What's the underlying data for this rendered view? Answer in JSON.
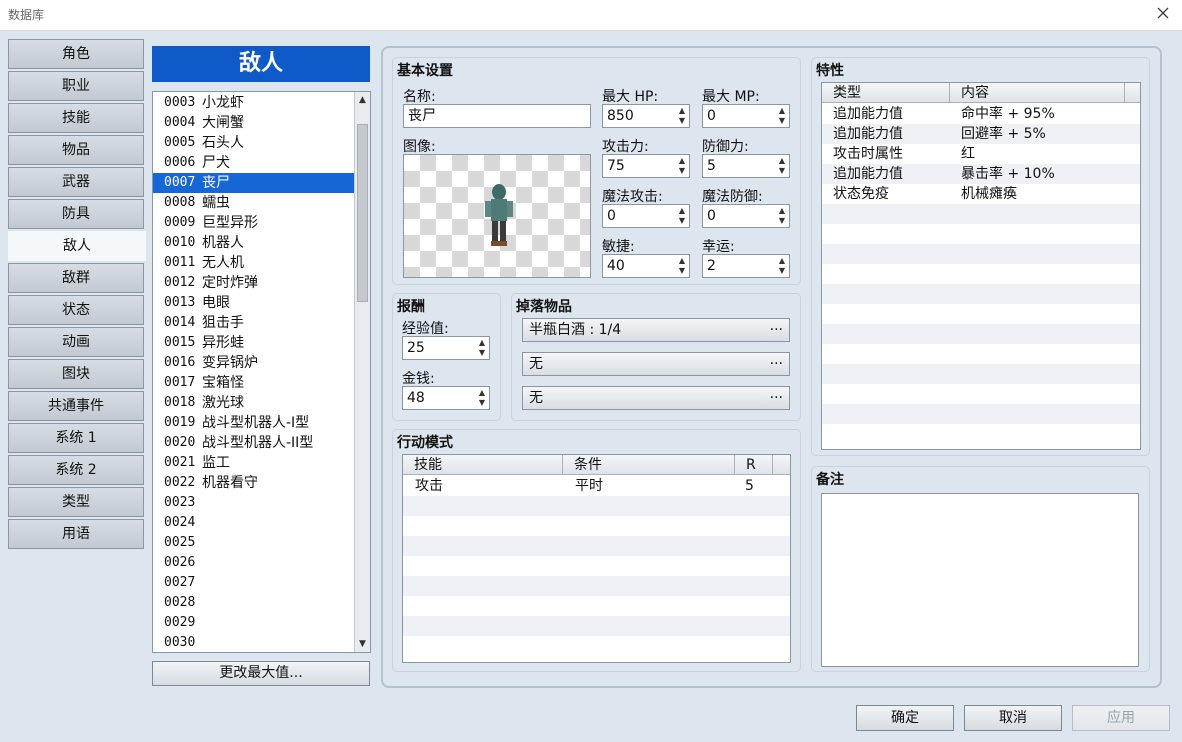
{
  "window": {
    "title": "数据库"
  },
  "nav": {
    "items": [
      "角色",
      "职业",
      "技能",
      "物品",
      "武器",
      "防具",
      "敌人",
      "敌群",
      "状态",
      "动画",
      "图块",
      "共通事件",
      "系统 1",
      "系统 2",
      "类型",
      "用语"
    ],
    "active_index": 6
  },
  "enemy_list": {
    "header": "敌人",
    "rows": [
      {
        "id": "0003",
        "name": "小龙虾"
      },
      {
        "id": "0004",
        "name": "大闸蟹"
      },
      {
        "id": "0005",
        "name": "石头人"
      },
      {
        "id": "0006",
        "name": "尸犬"
      },
      {
        "id": "0007",
        "name": "丧尸"
      },
      {
        "id": "0008",
        "name": "蠕虫"
      },
      {
        "id": "0009",
        "name": "巨型异形"
      },
      {
        "id": "0010",
        "name": "机器人"
      },
      {
        "id": "0011",
        "name": "无人机"
      },
      {
        "id": "0012",
        "name": "定时炸弹"
      },
      {
        "id": "0013",
        "name": "电眼"
      },
      {
        "id": "0014",
        "name": "狙击手"
      },
      {
        "id": "0015",
        "name": "异形蛙"
      },
      {
        "id": "0016",
        "name": "变异锅炉"
      },
      {
        "id": "0017",
        "name": "宝箱怪"
      },
      {
        "id": "0018",
        "name": "激光球"
      },
      {
        "id": "0019",
        "name": "战斗型机器人-I型"
      },
      {
        "id": "0020",
        "name": "战斗型机器人-II型"
      },
      {
        "id": "0021",
        "name": "监工"
      },
      {
        "id": "0022",
        "name": "机器看守"
      },
      {
        "id": "0023",
        "name": ""
      },
      {
        "id": "0024",
        "name": ""
      },
      {
        "id": "0025",
        "name": ""
      },
      {
        "id": "0026",
        "name": ""
      },
      {
        "id": "0027",
        "name": ""
      },
      {
        "id": "0028",
        "name": ""
      },
      {
        "id": "0029",
        "name": ""
      },
      {
        "id": "0030",
        "name": ""
      }
    ],
    "selected_id": "0007",
    "change_max_button": "更改最大值..."
  },
  "basic": {
    "title": "基本设置",
    "name_label": "名称:",
    "name_value": "丧尸",
    "image_label": "图像:",
    "max_hp_label": "最大 HP:",
    "max_hp": "850",
    "max_mp_label": "最大 MP:",
    "max_mp": "0",
    "atk_label": "攻击力:",
    "atk": "75",
    "def_label": "防御力:",
    "def": "5",
    "mat_label": "魔法攻击:",
    "mat": "0",
    "mdf_label": "魔法防御:",
    "mdf": "0",
    "agi_label": "敏捷:",
    "agi": "40",
    "luk_label": "幸运:",
    "luk": "2"
  },
  "rewards": {
    "title": "报酬",
    "exp_label": "经验值:",
    "exp": "25",
    "gold_label": "金钱:",
    "gold": "48"
  },
  "drops": {
    "title": "掉落物品",
    "items": [
      "半瓶白酒 : 1/4",
      "无",
      "无"
    ],
    "dots": "···"
  },
  "actions": {
    "title": "行动模式",
    "headers": [
      "技能",
      "条件",
      "R"
    ],
    "rows": [
      {
        "skill": "攻击",
        "condition": "平时",
        "rating": "5"
      }
    ]
  },
  "traits": {
    "title": "特性",
    "headers": [
      "类型",
      "内容"
    ],
    "rows": [
      {
        "type": "追加能力值",
        "content": "命中率 + 95%"
      },
      {
        "type": "追加能力值",
        "content": "回避率 + 5%"
      },
      {
        "type": "攻击时属性",
        "content": "红"
      },
      {
        "type": "追加能力值",
        "content": "暴击率 + 10%"
      },
      {
        "type": "状态免疫",
        "content": "机械瘫痪"
      }
    ]
  },
  "notes": {
    "title": "备注",
    "value": ""
  },
  "footer": {
    "ok": "确定",
    "cancel": "取消",
    "apply": "应用"
  },
  "colors": {
    "accent": "#0f5ac9",
    "selection": "#1566d6",
    "background": "#dde6ee"
  }
}
